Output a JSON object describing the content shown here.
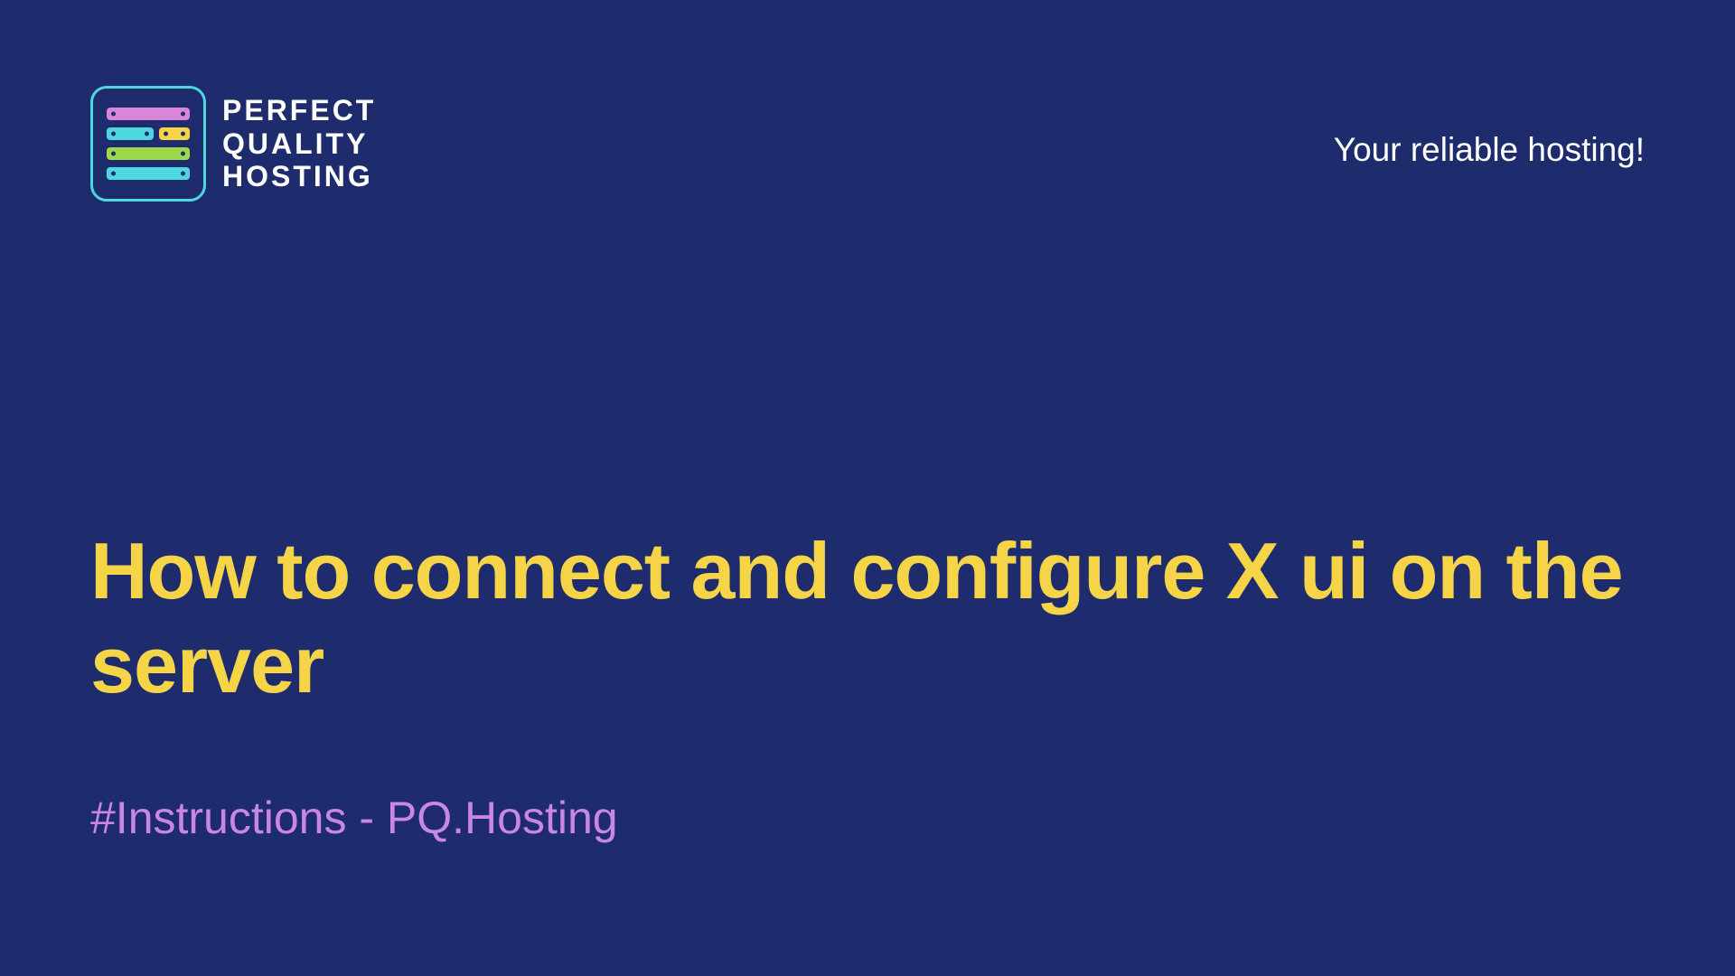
{
  "logo": {
    "line1": "PERFECT",
    "line2": "QUALITY",
    "line3": "HOSTING"
  },
  "tagline": "Your reliable hosting!",
  "title": "How to connect and configure X ui on the server",
  "subtitle": "#Instructions - PQ.Hosting"
}
